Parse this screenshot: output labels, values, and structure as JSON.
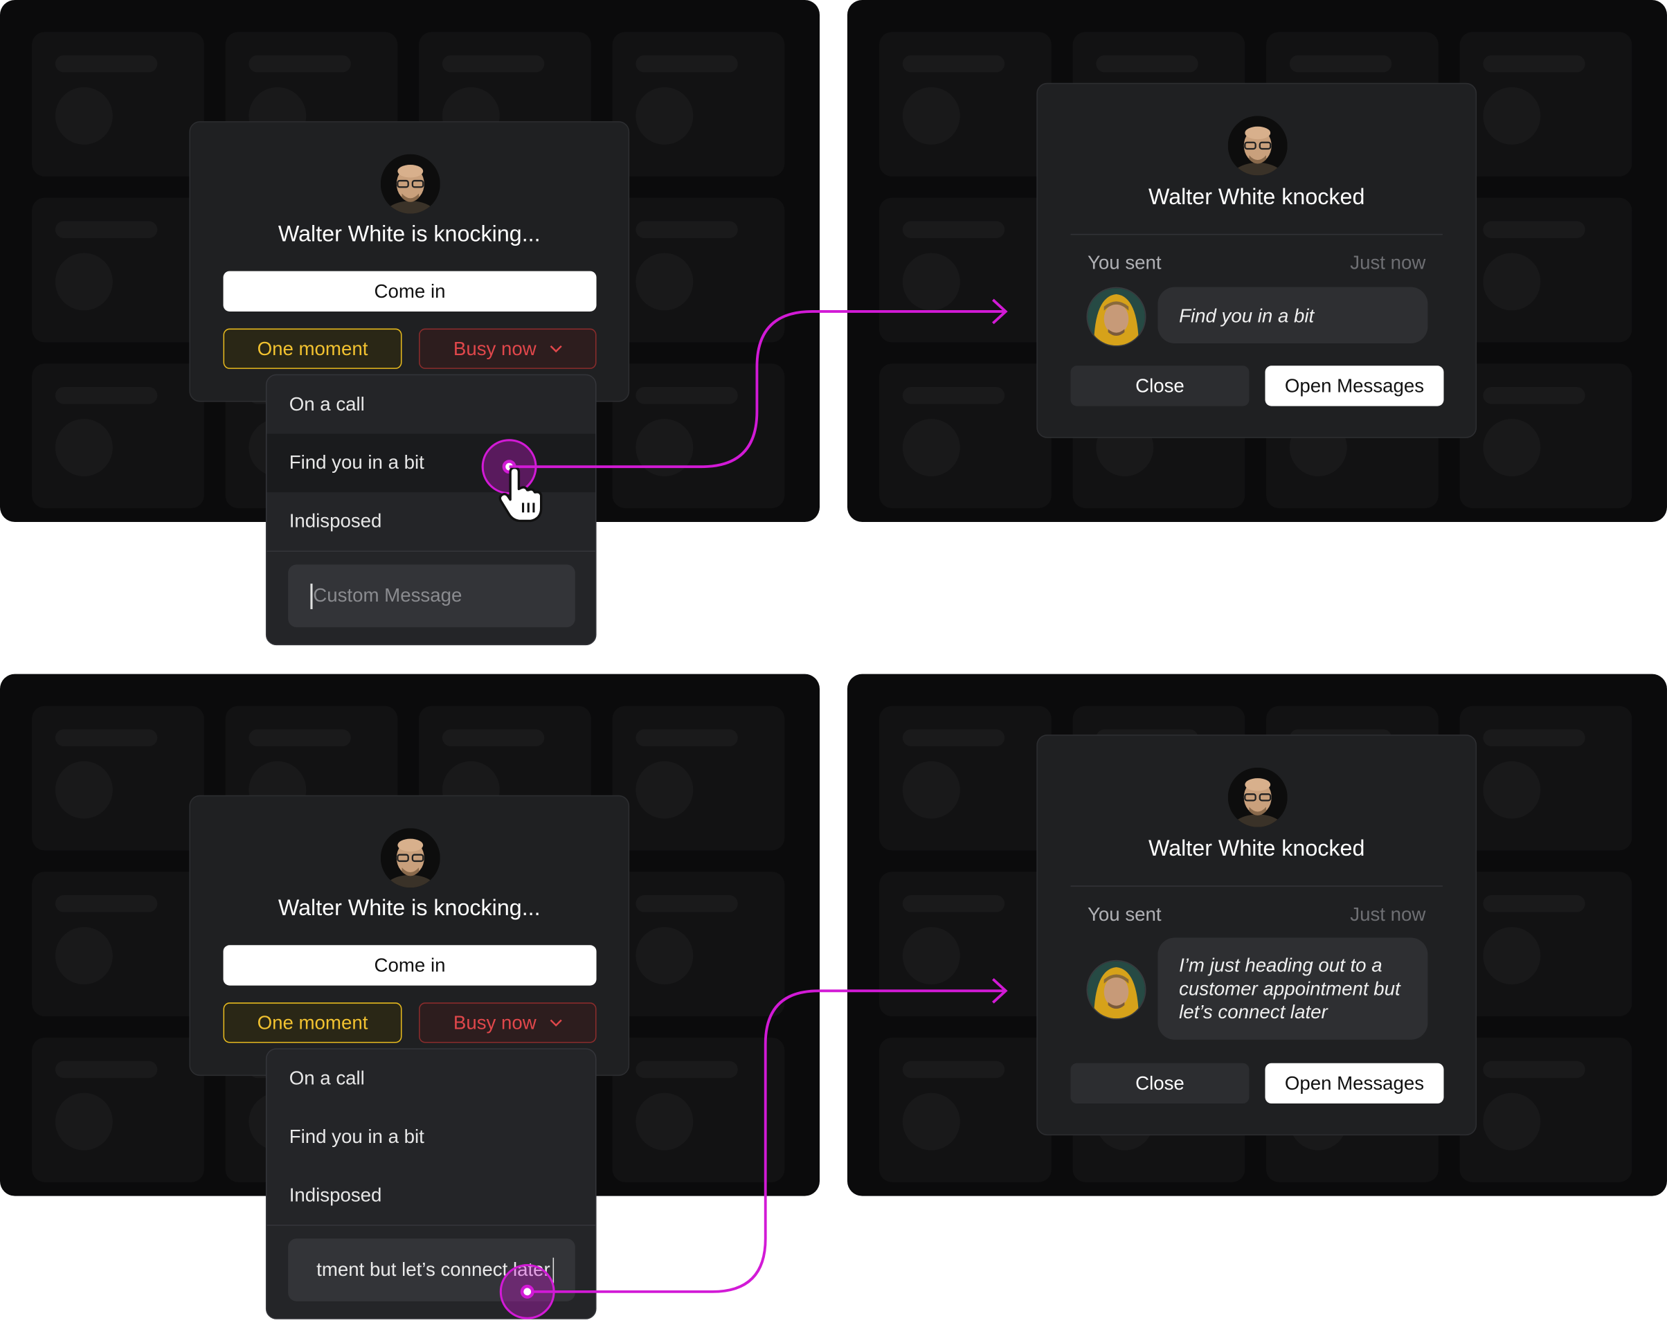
{
  "accent_color": "#d21ad6",
  "knock_dialog": {
    "title": "Walter White is knocking...",
    "come_in": "Come in",
    "one_moment": "One moment",
    "busy_now": "Busy now",
    "avatar_icon": "walter-white-avatar"
  },
  "dropdown": {
    "items": [
      "On a call",
      "Find you in a bit",
      "Indisposed"
    ],
    "custom_placeholder": "Custom Message",
    "typed_value": "tment but let’s connect later"
  },
  "knocked_dialog": {
    "title": "Walter White knocked",
    "you_sent": "You sent",
    "time": "Just now",
    "close": "Close",
    "open_messages": "Open Messages",
    "sender_avatar_icon": "jesse-pinkman-avatar"
  },
  "messages": {
    "first": "Find you in a bit",
    "second": "I’m just heading out to a customer appointment but let’s connect later"
  }
}
